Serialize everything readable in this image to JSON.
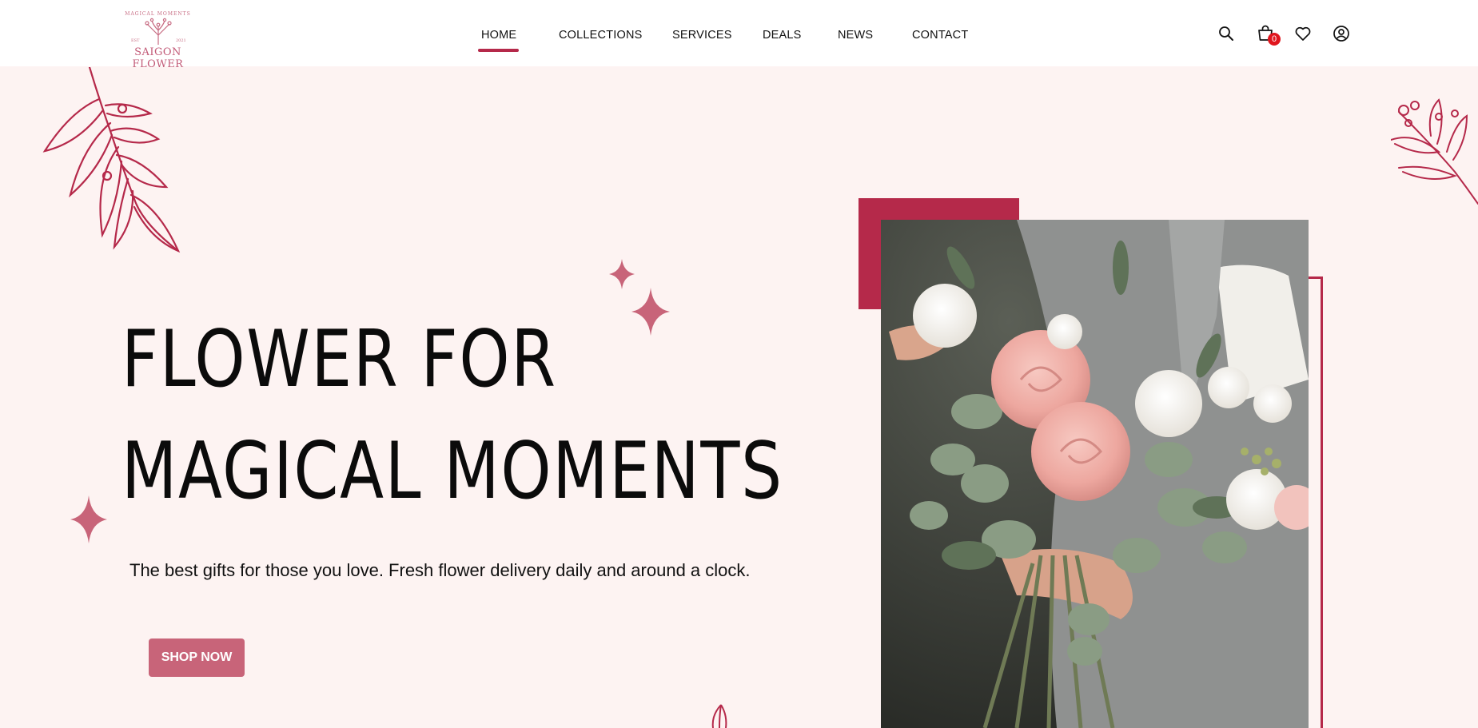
{
  "brand": {
    "tagline": "MAGICAL MOMENTS",
    "name": "SAIGON FLOWER",
    "est": "EST",
    "year": "2021"
  },
  "nav": {
    "items": [
      {
        "label": "HOME",
        "active": true
      },
      {
        "label": "COLLECTIONS"
      },
      {
        "label": "SERVICES"
      },
      {
        "label": "DEALS"
      },
      {
        "label": "NEWS"
      },
      {
        "label": "CONTACT"
      }
    ]
  },
  "header_icons": {
    "search": "search-icon",
    "cart": "shopping-bag-icon",
    "cart_count": "0",
    "wishlist": "heart-icon",
    "account": "user-circle-icon"
  },
  "hero": {
    "title_line1": "FLOWER FOR",
    "title_line2": "MAGICAL MOMENTS",
    "subtitle": "The best gifts for those you love. Fresh flower delivery daily and around a clock.",
    "cta": "SHOP NOW"
  },
  "colors": {
    "accent": "#b5294a",
    "button": "#c86479",
    "background": "#fdf3f2",
    "badge": "#e0161e"
  }
}
